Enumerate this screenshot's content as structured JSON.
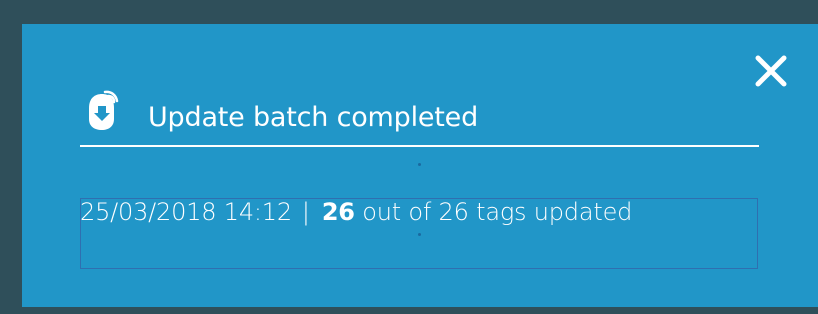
{
  "notification": {
    "title": "Update batch completed",
    "timestamp": "25/03/2018 14:12",
    "separator": "|",
    "updated_count": "26",
    "summary_text": "out of 26 tags updated"
  },
  "icons": {
    "header": "tag-download-wireless-icon",
    "close": "close-icon"
  },
  "colors": {
    "panel_background": "#2196c8",
    "page_background": "#2f4f5a",
    "text": "#ffffff"
  }
}
